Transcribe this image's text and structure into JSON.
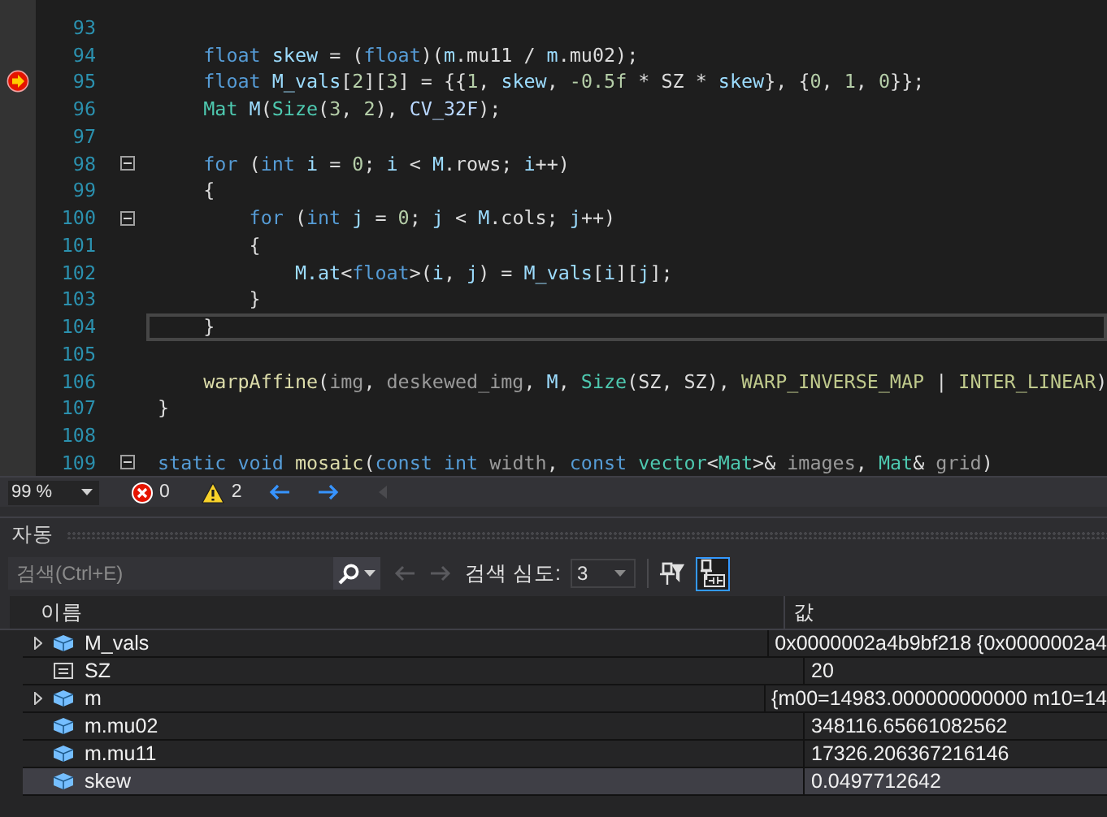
{
  "editor": {
    "lines": [
      {
        "number": "93",
        "caret": false,
        "current": false
      },
      {
        "number": "94",
        "caret": false,
        "current": false,
        "tokens": [
          {
            "kind": "kw",
            "text": "    float"
          },
          {
            "kind": "var",
            "text": " skew"
          },
          {
            "kind": "plain",
            "text": " = ("
          },
          {
            "kind": "kw",
            "text": "float"
          },
          {
            "kind": "plain",
            "text": ")("
          },
          {
            "kind": "var",
            "text": "m"
          },
          {
            "kind": "plain",
            "text": ".mu11 / "
          },
          {
            "kind": "var",
            "text": "m"
          },
          {
            "kind": "plain",
            "text": ".mu02);"
          }
        ]
      },
      {
        "number": "95",
        "caret": false,
        "current": true,
        "tokens": [
          {
            "kind": "kw",
            "text": "    float"
          },
          {
            "kind": "var",
            "text": " M_vals"
          },
          {
            "kind": "plain",
            "text": "["
          },
          {
            "kind": "num",
            "text": "2"
          },
          {
            "kind": "plain",
            "text": "]["
          },
          {
            "kind": "num",
            "text": "3"
          },
          {
            "kind": "plain",
            "text": "] = {{"
          },
          {
            "kind": "num",
            "text": "1"
          },
          {
            "kind": "plain",
            "text": ","
          },
          {
            "kind": "var",
            "text": " skew"
          },
          {
            "kind": "plain",
            "text": ","
          },
          {
            "kind": "num",
            "text": " -0.5f"
          },
          {
            "kind": "plain",
            "text": " * SZ *"
          },
          {
            "kind": "var",
            "text": " skew"
          },
          {
            "kind": "plain",
            "text": "}, {"
          },
          {
            "kind": "num",
            "text": "0"
          },
          {
            "kind": "plain",
            "text": ","
          },
          {
            "kind": "num",
            "text": " 1"
          },
          {
            "kind": "plain",
            "text": ","
          },
          {
            "kind": "num",
            "text": " 0"
          },
          {
            "kind": "plain",
            "text": "}};"
          }
        ]
      },
      {
        "number": "96",
        "caret": false,
        "current": false,
        "tokens": [
          {
            "kind": "type",
            "text": "    Mat"
          },
          {
            "kind": "var",
            "text": " M"
          },
          {
            "kind": "plain",
            "text": "("
          },
          {
            "kind": "type",
            "text": "Size"
          },
          {
            "kind": "plain",
            "text": "("
          },
          {
            "kind": "num",
            "text": "3"
          },
          {
            "kind": "plain",
            "text": ","
          },
          {
            "kind": "num",
            "text": " 2"
          },
          {
            "kind": "plain",
            "text": "),"
          },
          {
            "kind": "enum",
            "text": " CV_32F"
          },
          {
            "kind": "plain",
            "text": ");"
          }
        ]
      },
      {
        "number": "97",
        "caret": false,
        "current": false
      },
      {
        "number": "98",
        "caret": false,
        "current": false,
        "kind": "fold",
        "expanded": true,
        "tokens": [
          {
            "kind": "kw",
            "text": "    for"
          },
          {
            "kind": "plain",
            "text": " ("
          },
          {
            "kind": "kw",
            "text": "int"
          },
          {
            "kind": "var",
            "text": " i"
          },
          {
            "kind": "plain",
            "text": " ="
          },
          {
            "kind": "num",
            "text": " 0"
          },
          {
            "kind": "plain",
            "text": ";"
          },
          {
            "kind": "var",
            "text": " i"
          },
          {
            "kind": "plain",
            "text": " <"
          },
          {
            "kind": "var",
            "text": " M"
          },
          {
            "kind": "plain",
            "text": ".rows;"
          },
          {
            "kind": "var",
            "text": " i"
          },
          {
            "kind": "plain",
            "text": "++)"
          }
        ]
      },
      {
        "number": "99",
        "caret": false,
        "current": false,
        "tokens": [
          {
            "kind": "plain",
            "text": "    {"
          }
        ]
      },
      {
        "number": "100",
        "caret": false,
        "current": false,
        "kind": "fold",
        "expanded": true,
        "tokens": [
          {
            "kind": "kw",
            "text": "        for"
          },
          {
            "kind": "plain",
            "text": " ("
          },
          {
            "kind": "kw",
            "text": "int"
          },
          {
            "kind": "var",
            "text": " j"
          },
          {
            "kind": "plain",
            "text": " ="
          },
          {
            "kind": "num",
            "text": " 0"
          },
          {
            "kind": "plain",
            "text": ";"
          },
          {
            "kind": "var",
            "text": " j"
          },
          {
            "kind": "plain",
            "text": " <"
          },
          {
            "kind": "var",
            "text": " M"
          },
          {
            "kind": "plain",
            "text": ".cols;"
          },
          {
            "kind": "var",
            "text": " j"
          },
          {
            "kind": "plain",
            "text": "++)"
          }
        ]
      },
      {
        "number": "101",
        "caret": false,
        "current": false,
        "tokens": [
          {
            "kind": "plain",
            "text": "        {"
          }
        ]
      },
      {
        "number": "102",
        "caret": false,
        "current": false,
        "tokens": [
          {
            "kind": "var",
            "text": "            M.at"
          },
          {
            "kind": "plain",
            "text": "<"
          },
          {
            "kind": "kw",
            "text": "float"
          },
          {
            "kind": "plain",
            "text": ">("
          },
          {
            "kind": "var",
            "text": "i"
          },
          {
            "kind": "plain",
            "text": ","
          },
          {
            "kind": "var",
            "text": " j"
          },
          {
            "kind": "plain",
            "text": ") ="
          },
          {
            "kind": "var",
            "text": " M_vals"
          },
          {
            "kind": "plain",
            "text": "["
          },
          {
            "kind": "var",
            "text": "i"
          },
          {
            "kind": "plain",
            "text": "]["
          },
          {
            "kind": "var",
            "text": "j"
          },
          {
            "kind": "plain",
            "text": "];"
          }
        ]
      },
      {
        "number": "103",
        "caret": false,
        "current": false,
        "tokens": [
          {
            "kind": "plain",
            "text": "        }"
          }
        ]
      },
      {
        "number": "104",
        "caret": true,
        "current": false,
        "tokens": [
          {
            "kind": "plain",
            "text": "    }"
          }
        ]
      },
      {
        "number": "105",
        "caret": false,
        "current": false
      },
      {
        "number": "106",
        "caret": false,
        "current": false,
        "tokens": [
          {
            "kind": "fn",
            "text": "    warpAffine"
          },
          {
            "kind": "plain",
            "text": "("
          },
          {
            "kind": "param",
            "text": "img"
          },
          {
            "kind": "plain",
            "text": ","
          },
          {
            "kind": "param",
            "text": " deskewed_img"
          },
          {
            "kind": "plain",
            "text": ","
          },
          {
            "kind": "var",
            "text": " M"
          },
          {
            "kind": "plain",
            "text": ","
          },
          {
            "kind": "type",
            "text": " Size"
          },
          {
            "kind": "plain",
            "text": "(SZ, SZ),"
          },
          {
            "kind": "macro",
            "text": " WARP_INVERSE_MAP"
          },
          {
            "kind": "plain",
            "text": " |"
          },
          {
            "kind": "macro",
            "text": " INTER_LINEAR"
          },
          {
            "kind": "plain",
            "text": ")"
          }
        ]
      },
      {
        "number": "107",
        "caret": false,
        "current": false,
        "tokens": [
          {
            "kind": "plain",
            "text": "}"
          }
        ]
      },
      {
        "number": "108",
        "caret": false,
        "current": false
      },
      {
        "number": "109",
        "caret": false,
        "current": false,
        "kind": "fold",
        "expanded": true,
        "tokens": [
          {
            "kind": "kw",
            "text": "static"
          },
          {
            "kind": "kw",
            "text": " void"
          },
          {
            "kind": "fn",
            "text": " mosaic"
          },
          {
            "kind": "plain",
            "text": "("
          },
          {
            "kind": "kw",
            "text": "const"
          },
          {
            "kind": "kw",
            "text": " int"
          },
          {
            "kind": "param",
            "text": " width"
          },
          {
            "kind": "plain",
            "text": ","
          },
          {
            "kind": "kw",
            "text": " const"
          },
          {
            "kind": "type",
            "text": " vector"
          },
          {
            "kind": "plain",
            "text": "<"
          },
          {
            "kind": "type",
            "text": "Mat"
          },
          {
            "kind": "plain",
            "text": ">&"
          },
          {
            "kind": "param",
            "text": " images"
          },
          {
            "kind": "plain",
            "text": ","
          },
          {
            "kind": "type",
            "text": " Mat"
          },
          {
            "kind": "plain",
            "text": "&"
          },
          {
            "kind": "param",
            "text": " grid"
          },
          {
            "kind": "plain",
            "text": ")"
          }
        ]
      }
    ]
  },
  "status_bar": {
    "zoom": "99 %",
    "errors": "0",
    "warnings": "2"
  },
  "autos": {
    "title": "자동",
    "search": {
      "placeholder": "검색(Ctrl+E)"
    },
    "nav_disabled": true,
    "depth_label": "검색 심도:",
    "depth": "3",
    "tool_buttons": [
      {
        "kind": "pin-filter",
        "selected": false
      },
      {
        "kind": "hex",
        "selected": true
      }
    ],
    "columns": [
      "이름",
      "값"
    ],
    "rows": [
      {
        "kind": "field",
        "expandable": true,
        "selected": false,
        "name": "M_vals",
        "value": "0x0000002a4b9bf218 {0x0000002a4"
      },
      {
        "kind": "constant",
        "expandable": false,
        "selected": false,
        "name": "SZ",
        "value": "20"
      },
      {
        "kind": "field",
        "expandable": true,
        "selected": false,
        "name": "m",
        "value": "{m00=14983.000000000000 m10=14"
      },
      {
        "kind": "field",
        "expandable": false,
        "selected": false,
        "name": "m.mu02",
        "value": "348116.65661082562"
      },
      {
        "kind": "field",
        "expandable": false,
        "selected": false,
        "name": "m.mu11",
        "value": "17326.206367216146"
      },
      {
        "kind": "field",
        "expandable": false,
        "selected": true,
        "name": "skew",
        "value": "0.0497712642"
      }
    ]
  }
}
